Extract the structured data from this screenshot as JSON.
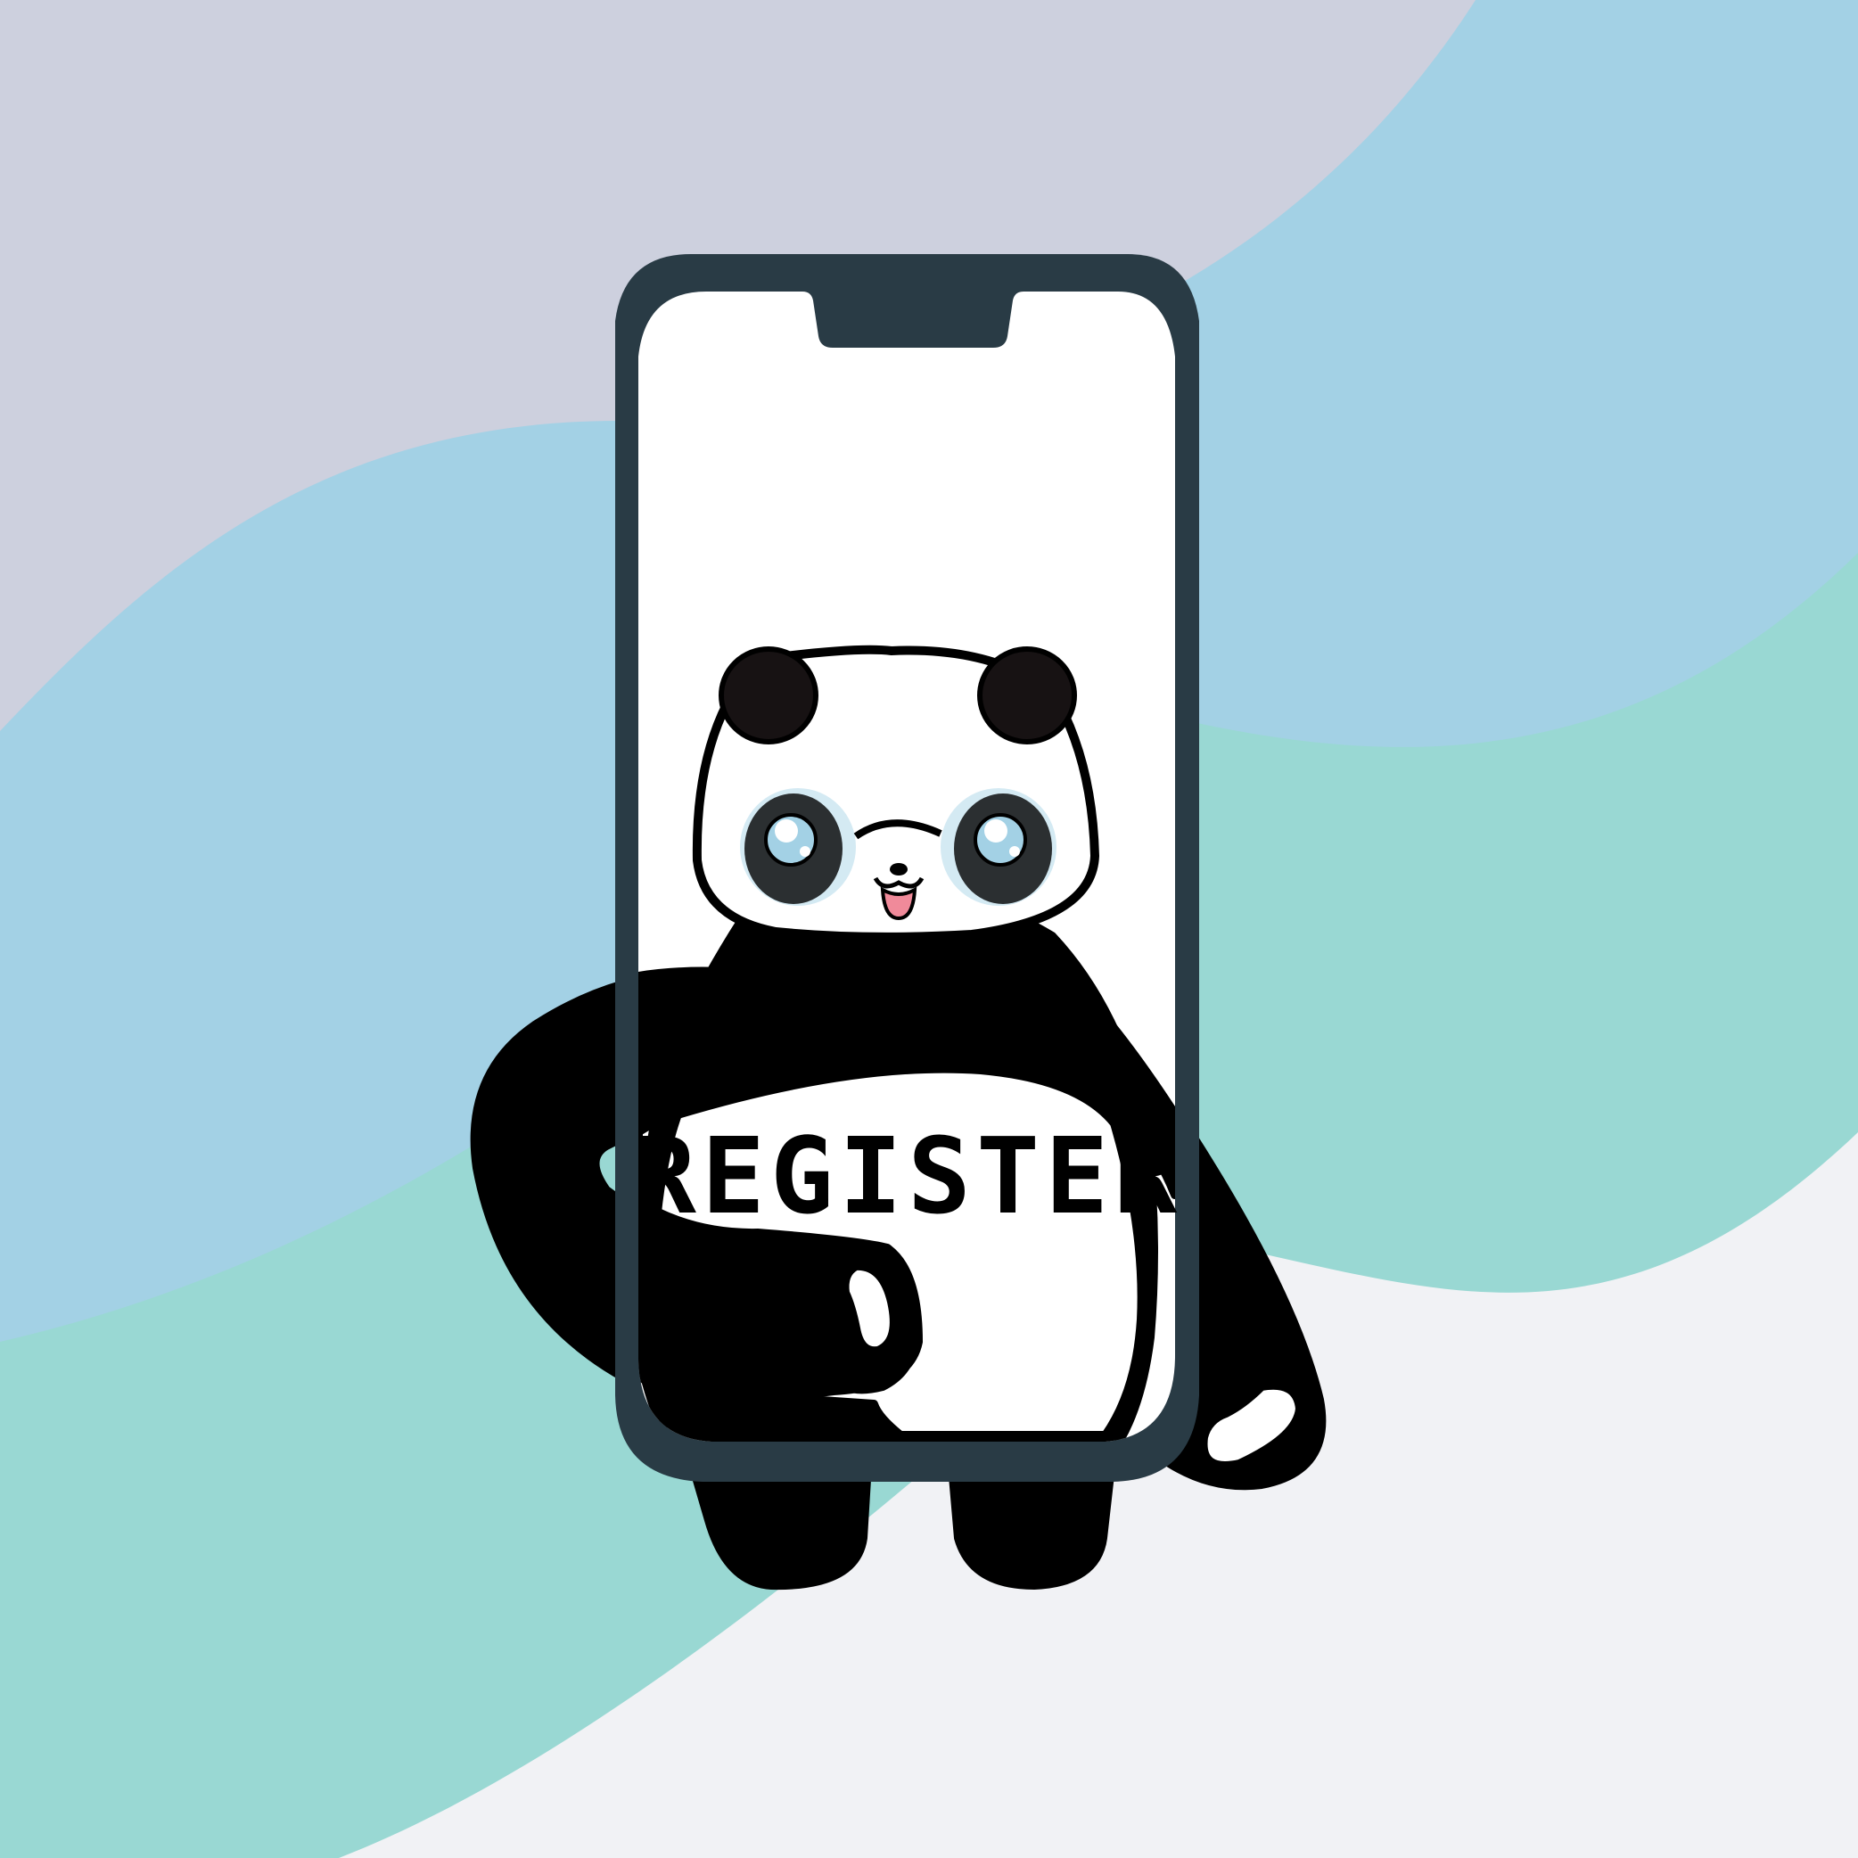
{
  "colors": {
    "band_lavender": "#cdd0de",
    "band_blue": "#a3d1e5",
    "band_teal": "#99d8d3",
    "band_light": "#f1f2f5",
    "phone_frame": "#293b45",
    "screen": "#ffffff",
    "panda_black": "#000000",
    "panda_white": "#ffffff",
    "eye_glow": "#d4eaf3",
    "tongue": "#f08a9a"
  },
  "icons": {
    "phone": "smartphone-icon",
    "mascot": "panda-icon"
  },
  "screen": {
    "button_label": "REGISTER"
  }
}
